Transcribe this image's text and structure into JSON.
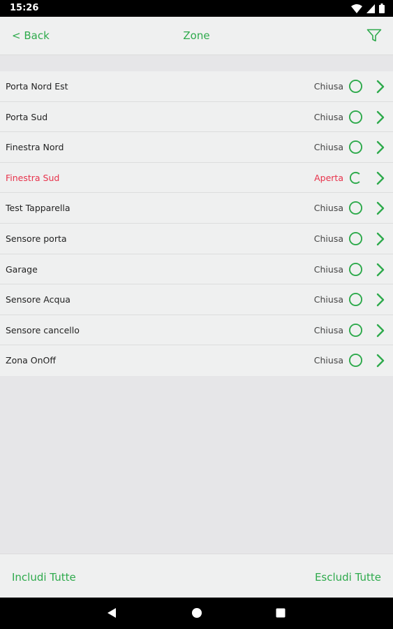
{
  "status_bar": {
    "time": "15:26"
  },
  "header": {
    "back_label": "< Back",
    "title": "Zone"
  },
  "zones": [
    {
      "name": "Porta Nord Est",
      "status": "Chiusa",
      "open": false
    },
    {
      "name": "Porta Sud",
      "status": "Chiusa",
      "open": false
    },
    {
      "name": "Finestra Nord",
      "status": "Chiusa",
      "open": false
    },
    {
      "name": "Finestra Sud",
      "status": "Aperta",
      "open": true
    },
    {
      "name": "Test Tapparella",
      "status": "Chiusa",
      "open": false
    },
    {
      "name": "Sensore porta",
      "status": "Chiusa",
      "open": false
    },
    {
      "name": "Garage",
      "status": "Chiusa",
      "open": false
    },
    {
      "name": "Sensore Acqua",
      "status": "Chiusa",
      "open": false
    },
    {
      "name": "Sensore cancello",
      "status": "Chiusa",
      "open": false
    },
    {
      "name": "Zona OnOff",
      "status": "Chiusa",
      "open": false
    }
  ],
  "footer": {
    "include_all": "Includi Tutte",
    "exclude_all": "Escludi Tutte"
  },
  "icons": {
    "filter": "filter-icon",
    "ring_closed": "closed-ring-icon",
    "ring_open": "open-ring-icon",
    "chevron": "chevron-right-icon",
    "wifi": "wifi-icon",
    "signal": "signal-icon",
    "battery": "battery-icon",
    "back": "back-triangle-icon",
    "home": "home-circle-icon",
    "recents": "recents-square-icon"
  },
  "colors": {
    "accent": "#2eaa4c",
    "alert": "#e8324b",
    "background": "#e6e6e8",
    "surface": "#eff0f0"
  }
}
